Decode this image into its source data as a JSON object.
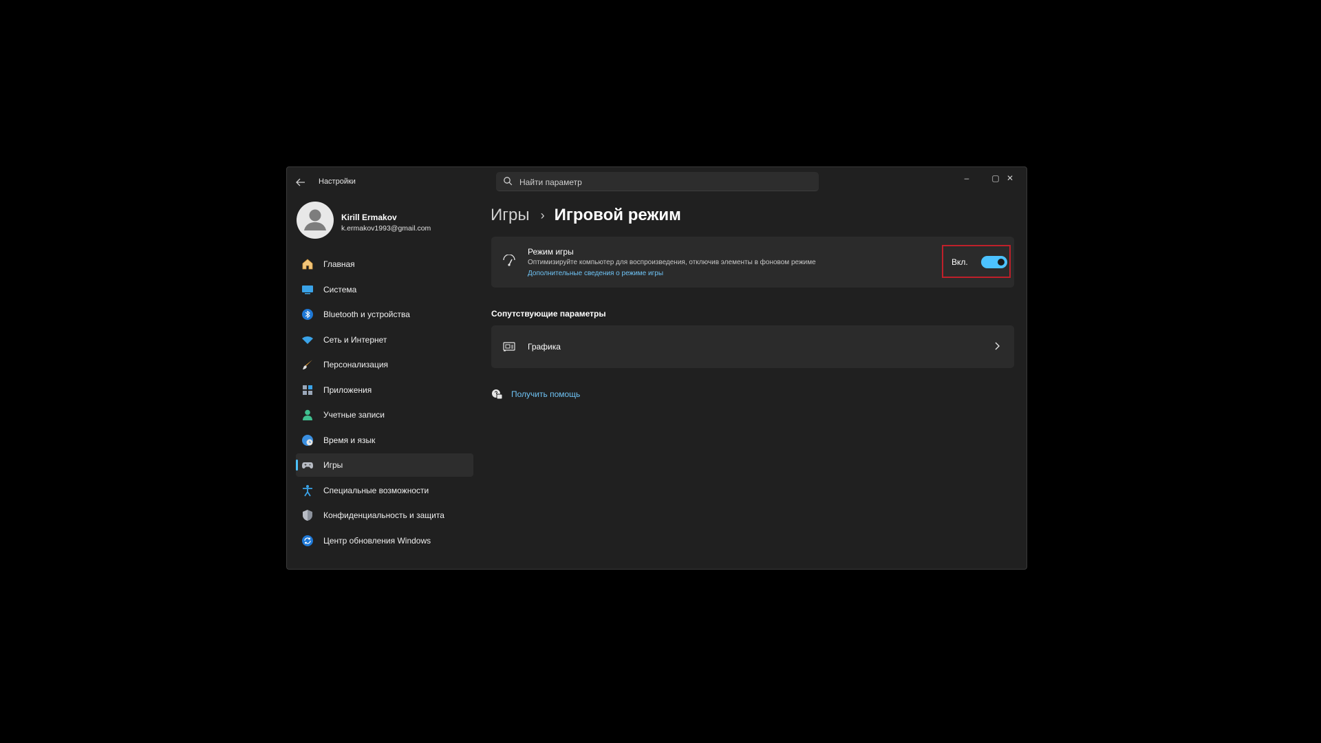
{
  "window": {
    "title": "Настройки",
    "controls": {
      "minimize": "–",
      "maximize": "▢",
      "close": "✕"
    }
  },
  "search": {
    "placeholder": "Найти параметр"
  },
  "profile": {
    "name": "Kirill Ermakov",
    "email": "k.ermakov1993@gmail.com"
  },
  "sidebar": {
    "items": [
      {
        "label": "Главная",
        "icon": "home-icon",
        "active": false
      },
      {
        "label": "Система",
        "icon": "system-icon",
        "active": false
      },
      {
        "label": "Bluetooth и устройства",
        "icon": "bluetooth-icon",
        "active": false
      },
      {
        "label": "Сеть и Интернет",
        "icon": "wifi-icon",
        "active": false
      },
      {
        "label": "Персонализация",
        "icon": "brush-icon",
        "active": false
      },
      {
        "label": "Приложения",
        "icon": "apps-icon",
        "active": false
      },
      {
        "label": "Учетные записи",
        "icon": "account-icon",
        "active": false
      },
      {
        "label": "Время и язык",
        "icon": "globe-clock-icon",
        "active": false
      },
      {
        "label": "Игры",
        "icon": "gamepad-icon",
        "active": true
      },
      {
        "label": "Специальные возможности",
        "icon": "accessibility-icon",
        "active": false
      },
      {
        "label": "Конфиденциальность и защита",
        "icon": "shield-icon",
        "active": false
      },
      {
        "label": "Центр обновления Windows",
        "icon": "update-icon",
        "active": false
      }
    ]
  },
  "breadcrumb": {
    "parent": "Игры",
    "separator": "›",
    "current": "Игровой режим"
  },
  "game_mode": {
    "title": "Режим игры",
    "description": "Оптимизируйте компьютер для воспроизведения, отключив элементы в фоновом режиме",
    "link": "Дополнительные сведения о режиме игры",
    "toggle_label": "Вкл.",
    "toggle_on": true
  },
  "related": {
    "section_title": "Сопутствующие параметры",
    "graphics_label": "Графика"
  },
  "help": {
    "label": "Получить помощь"
  },
  "colors": {
    "accent": "#4cc2ff",
    "highlight_border": "#c0202a",
    "window_bg": "#202020",
    "card_bg": "#2b2b2b"
  }
}
